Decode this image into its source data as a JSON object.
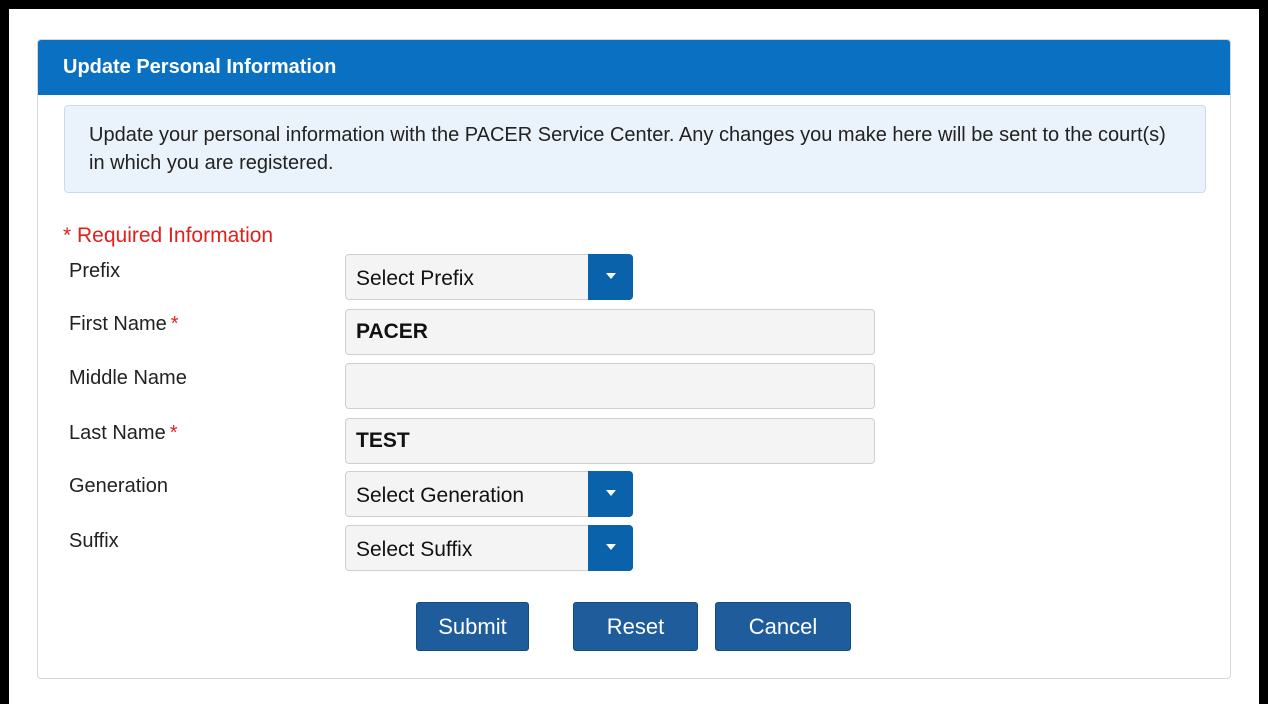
{
  "panel": {
    "title": "Update Personal Information",
    "info_text": "Update your personal information with the PACER Service Center. Any changes you make here will be sent to the court(s) in which you are registered."
  },
  "form": {
    "required_note": "* Required Information",
    "required_marker": "*",
    "prefix": {
      "label": "Prefix",
      "selected": "Select Prefix"
    },
    "first_name": {
      "label": "First Name",
      "value": "PACER"
    },
    "middle_name": {
      "label": "Middle Name",
      "value": ""
    },
    "last_name": {
      "label": "Last Name",
      "value": "TEST"
    },
    "generation": {
      "label": "Generation",
      "selected": "Select Generation"
    },
    "suffix": {
      "label": "Suffix",
      "selected": "Select Suffix"
    }
  },
  "buttons": {
    "submit": "Submit",
    "reset": "Reset",
    "cancel": "Cancel"
  },
  "colors": {
    "header_bg": "#0a70c2",
    "info_bg": "#eaf2fb",
    "required": "#e0201c",
    "button_bg": "#1f5c9c",
    "select_button_bg": "#0a62aa"
  }
}
